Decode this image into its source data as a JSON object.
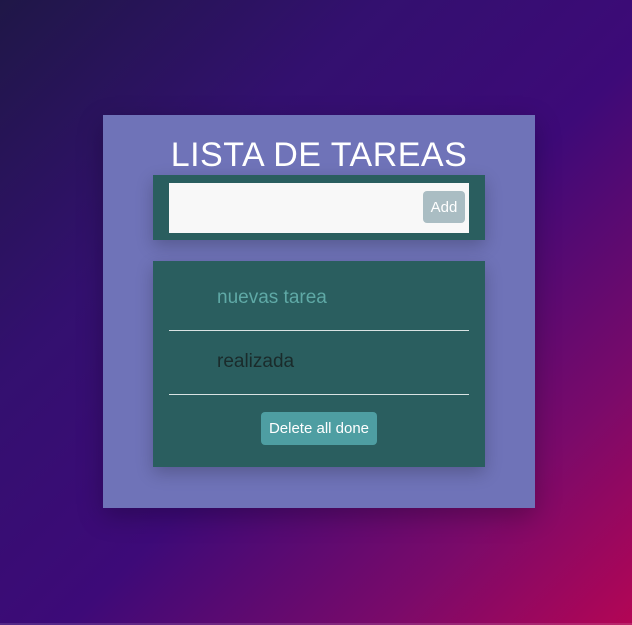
{
  "app": {
    "title": "LISTA DE TAREAS"
  },
  "input": {
    "value": "",
    "placeholder": "",
    "add_label": "Add"
  },
  "tasks": [
    {
      "text": "nuevas tarea",
      "status": "pending"
    },
    {
      "text": "realizada",
      "status": "done"
    }
  ],
  "actions": {
    "delete_done_label": "Delete all done"
  },
  "colors": {
    "card_background": "#6f73b8",
    "panel_background": "#2a5e5f",
    "pending_task_color": "#5fa9a6",
    "done_task_color": "#1a2b2b",
    "add_button_color": "#aabdc3",
    "delete_button_color": "#4e9ea2"
  }
}
